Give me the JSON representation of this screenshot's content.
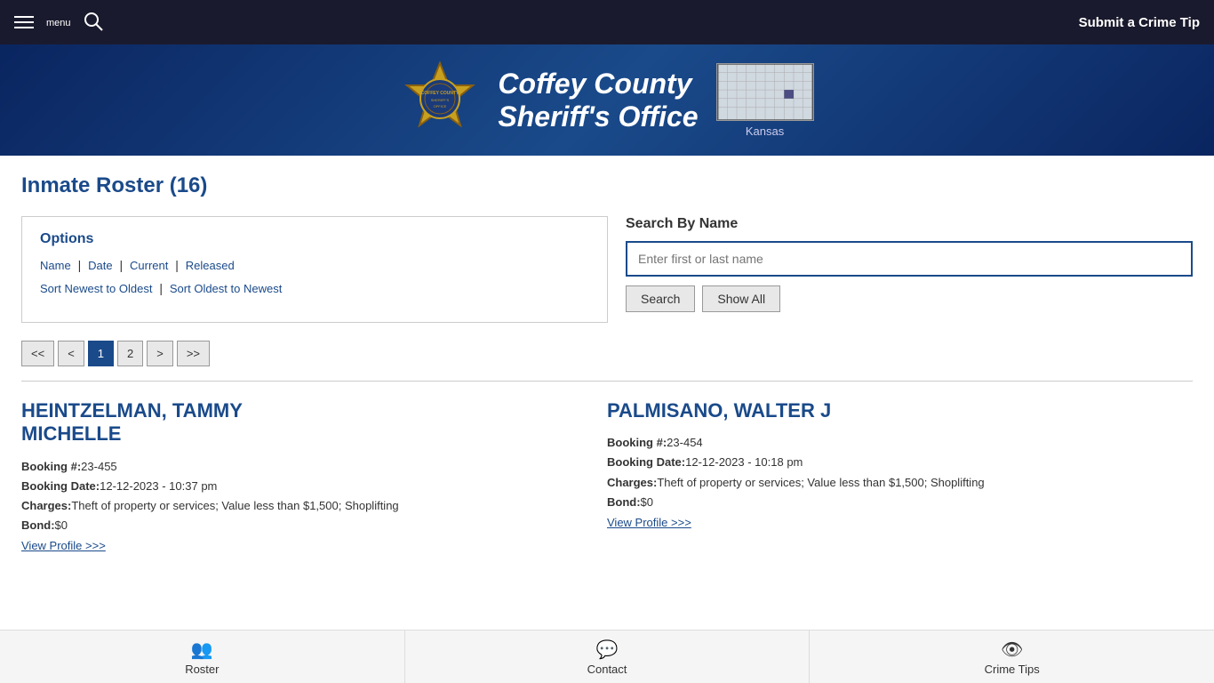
{
  "topNav": {
    "menuLabel": "menu",
    "submitCrimeTip": "Submit a Crime Tip"
  },
  "header": {
    "title1": "Coffey County",
    "title2": "Sheriff's Office",
    "stateLabel": "Kansas"
  },
  "page": {
    "title": "Inmate Roster (16)"
  },
  "options": {
    "title": "Options",
    "filterLinks": [
      {
        "label": "Name",
        "href": "#"
      },
      {
        "label": "Date",
        "href": "#"
      },
      {
        "label": "Current",
        "href": "#"
      },
      {
        "label": "Released",
        "href": "#"
      }
    ],
    "sortLinks": [
      {
        "label": "Sort Newest to Oldest",
        "href": "#"
      },
      {
        "label": "Sort Oldest to Newest",
        "href": "#"
      }
    ]
  },
  "searchByName": {
    "title": "Search By Name",
    "placeholder": "Enter first or last name",
    "searchBtn": "Search",
    "showAllBtn": "Show All"
  },
  "pagination": {
    "buttons": [
      {
        "label": "<<",
        "active": false
      },
      {
        "label": "<",
        "active": false
      },
      {
        "label": "1",
        "active": true
      },
      {
        "label": "2",
        "active": false
      },
      {
        "label": ">",
        "active": false
      },
      {
        "label": ">>",
        "active": false
      }
    ]
  },
  "inmates": [
    {
      "name": "HEINTZELMAN, TAMMY\nMICHELLE",
      "nameLine1": "HEINTZELMAN, TAMMY",
      "nameLine2": "MICHELLE",
      "bookingNum": "23-455",
      "bookingDate": "12-12-2023 - 10:37 pm",
      "charges": "Theft of property or services; Value less than $1,500; Shoplifting",
      "bond": "$0",
      "viewProfile": "View Profile >>>"
    },
    {
      "nameLine1": "PALMISANO, WALTER J",
      "nameLine2": "",
      "bookingNum": "23-454",
      "bookingDate": "12-12-2023 - 10:18 pm",
      "charges": "Theft of property or services; Value less than $1,500; Shoplifting",
      "bond": "$0",
      "viewProfile": "View Profile >>>"
    }
  ],
  "bottomNav": [
    {
      "icon": "👥",
      "label": "Roster"
    },
    {
      "icon": "💬",
      "label": "Contact"
    },
    {
      "icon": "👁",
      "label": "Crime Tips"
    }
  ]
}
